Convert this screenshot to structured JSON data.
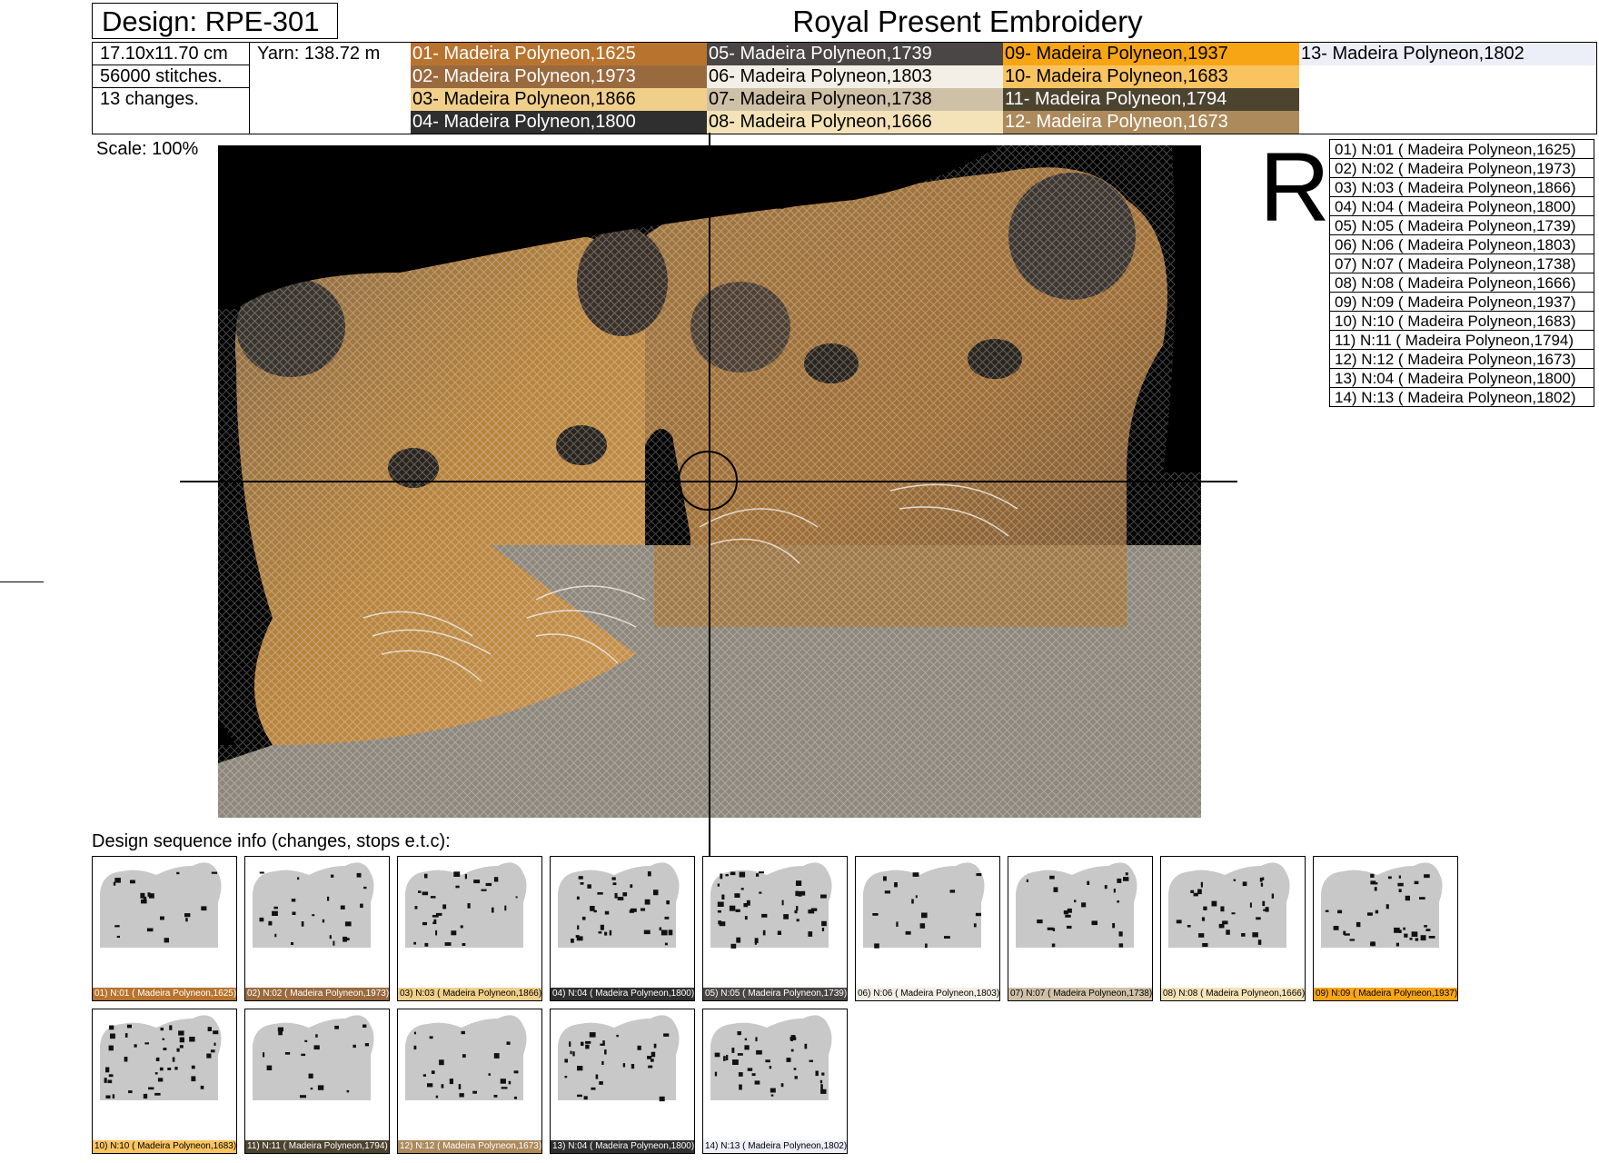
{
  "header": {
    "design": "Design: RPE-301",
    "brand": "Royal Present Embroidery"
  },
  "info": {
    "size": "17.10x11.70 cm",
    "yarn": "Yarn: 138.72 m",
    "stitches": "56000 stitches.",
    "changes": "13 changes."
  },
  "palette": [
    {
      "label": "01- Madeira Polyneon,1625",
      "color": "#b8742f",
      "text": "#ffffff"
    },
    {
      "label": "02- Madeira Polyneon,1973",
      "color": "#9a6a3f",
      "text": "#ffffff"
    },
    {
      "label": "03- Madeira Polyneon,1866",
      "color": "#f0cf8a",
      "text": "#000000"
    },
    {
      "label": "04- Madeira Polyneon,1800",
      "color": "#2f2f2f",
      "text": "#ffffff"
    },
    {
      "label": "05- Madeira Polyneon,1739",
      "color": "#4a4646",
      "text": "#ffffff"
    },
    {
      "label": "06- Madeira Polyneon,1803",
      "color": "#f3efe6",
      "text": "#000000"
    },
    {
      "label": "07- Madeira Polyneon,1738",
      "color": "#cfc1a8",
      "text": "#000000"
    },
    {
      "label": "08- Madeira Polyneon,1666",
      "color": "#f4e3b8",
      "text": "#000000"
    },
    {
      "label": "09- Madeira Polyneon,1937",
      "color": "#f8a515",
      "text": "#000000"
    },
    {
      "label": "10- Madeira Polyneon,1683",
      "color": "#f9c460",
      "text": "#000000"
    },
    {
      "label": "11- Madeira Polyneon,1794",
      "color": "#4d4430",
      "text": "#ffffff"
    },
    {
      "label": "12- Madeira Polyneon,1673",
      "color": "#ac8a5c",
      "text": "#ffffff"
    },
    {
      "label": "13- Madeira Polyneon,1802",
      "color": "#eceef8",
      "text": "#000000"
    }
  ],
  "scale": "Scale: 100%",
  "r_letter": "R",
  "legend": [
    "01) N:01 ( Madeira Polyneon,1625)",
    "02) N:02 ( Madeira Polyneon,1973)",
    "03) N:03 ( Madeira Polyneon,1866)",
    "04) N:04 ( Madeira Polyneon,1800)",
    "05) N:05 ( Madeira Polyneon,1739)",
    "06) N:06 ( Madeira Polyneon,1803)",
    "07) N:07 ( Madeira Polyneon,1738)",
    "08) N:08 ( Madeira Polyneon,1666)",
    "09) N:09 ( Madeira Polyneon,1937)",
    "10) N:10 ( Madeira Polyneon,1683)",
    "11) N:11 ( Madeira Polyneon,1794)",
    "12) N:12 ( Madeira Polyneon,1673)",
    "13) N:04 ( Madeira Polyneon,1800)",
    "14) N:13 ( Madeira Polyneon,1802)"
  ],
  "sequence_label": "Design sequence info (changes, stops e.t.c):",
  "thumbnails": [
    {
      "caption": "01) N:01 ( Madeira Polyneon,1625)",
      "color": "#b8742f",
      "text": "#ffffff"
    },
    {
      "caption": "02) N:02 ( Madeira Polyneon,1973)",
      "color": "#9a6a3f",
      "text": "#ffffff"
    },
    {
      "caption": "03) N:03 ( Madeira Polyneon,1866)",
      "color": "#f0cf8a",
      "text": "#000000"
    },
    {
      "caption": "04) N:04 ( Madeira Polyneon,1800)",
      "color": "#2f2f2f",
      "text": "#ffffff"
    },
    {
      "caption": "05) N:05 ( Madeira Polyneon,1739)",
      "color": "#4a4646",
      "text": "#ffffff"
    },
    {
      "caption": "06) N:06 ( Madeira Polyneon,1803)",
      "color": "#f3efe6",
      "text": "#000000"
    },
    {
      "caption": "07) N:07 ( Madeira Polyneon,1738)",
      "color": "#cfc1a8",
      "text": "#000000"
    },
    {
      "caption": "08) N:08 ( Madeira Polyneon,1666)",
      "color": "#f4e3b8",
      "text": "#000000"
    },
    {
      "caption": "09) N:09 ( Madeira Polyneon,1937)",
      "color": "#f8a515",
      "text": "#000000"
    },
    {
      "caption": "10) N:10 ( Madeira Polyneon,1683)",
      "color": "#f9c460",
      "text": "#000000"
    },
    {
      "caption": "11) N:11 ( Madeira Polyneon,1794)",
      "color": "#4d4430",
      "text": "#ffffff"
    },
    {
      "caption": "12) N:12 ( Madeira Polyneon,1673)",
      "color": "#ac8a5c",
      "text": "#ffffff"
    },
    {
      "caption": "13) N:04 ( Madeira Polyneon,1800)",
      "color": "#2f2f2f",
      "text": "#ffffff"
    },
    {
      "caption": "14) N:13 ( Madeira Polyneon,1802)",
      "color": "#eceef8",
      "text": "#000000"
    }
  ]
}
